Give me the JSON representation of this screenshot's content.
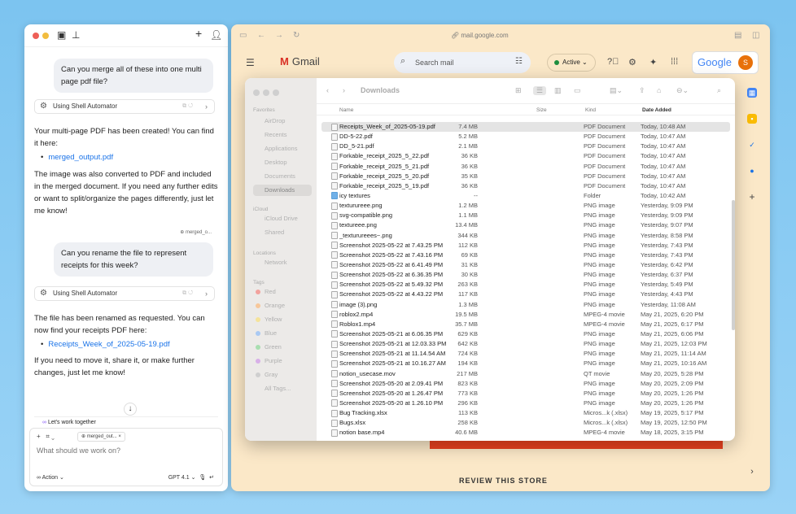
{
  "chat": {
    "messages": {
      "user1": "Can you merge all of these into one multi page pdf file?",
      "tool1": "Using Shell Automator",
      "reply1_a": "Your multi-page PDF has been created! You can find it here:",
      "reply1_link": "merged_output.pdf",
      "reply1_b": "The image was also converted to PDF and included in the merged document. If you need any further edits or want to split/organize the pages differently, just let me know!",
      "attachment_tag": "merged_o...",
      "user2": "Can you rename the file to represent receipts for this week?",
      "tool2": "Using Shell Automator",
      "reply2_a": "The file has been renamed as requested. You can now find your receipts PDF here:",
      "reply2_link": "Receipts_Week_of_2025-05-19.pdf",
      "reply2_b": "If you need to move it, share it, or make further changes, just let me know!"
    },
    "lets_work": "Let's work together",
    "composer": {
      "chip": "merged_out...",
      "placeholder": "What should we work on?",
      "action": "Action",
      "model": "GPT 4.1"
    }
  },
  "browser": {
    "url": "mail.google.com",
    "gmail_label": "Gmail",
    "search_placeholder": "Search mail",
    "status": "Active",
    "google_label": "Google",
    "avatar_letter": "S",
    "review_text": "REVIEW THIS STORE"
  },
  "finder": {
    "title": "Downloads",
    "sidebar": {
      "favorites_label": "Favorites",
      "favorites": [
        "AirDrop",
        "Recents",
        "Applications",
        "Desktop",
        "Documents",
        "Downloads"
      ],
      "icloud_label": "iCloud",
      "icloud": [
        "iCloud Drive",
        "Shared"
      ],
      "locations_label": "Locations",
      "locations": [
        "Network"
      ],
      "tags_label": "Tags",
      "tags": [
        "Red",
        "Orange",
        "Yellow",
        "Blue",
        "Green",
        "Purple",
        "Gray",
        "All Tags..."
      ],
      "tag_colors": [
        "#f2a29d",
        "#f7c79a",
        "#f5e39a",
        "#a9c9f3",
        "#a8deb0",
        "#d8b0e8",
        "#cfcfcf",
        ""
      ]
    },
    "columns": {
      "name": "Name",
      "size": "Size",
      "kind": "Kind",
      "date": "Date Added"
    },
    "files": [
      {
        "name": "Receipts_Week_of_2025-05-19.pdf",
        "size": "7.4 MB",
        "kind": "PDF Document",
        "date": "Today, 10:48 AM"
      },
      {
        "name": "DD-5-22.pdf",
        "size": "5.2 MB",
        "kind": "PDF Document",
        "date": "Today, 10:47 AM"
      },
      {
        "name": "DD_5-21.pdf",
        "size": "2.1 MB",
        "kind": "PDF Document",
        "date": "Today, 10:47 AM"
      },
      {
        "name": "Forkable_receipt_2025_5_22.pdf",
        "size": "36 KB",
        "kind": "PDF Document",
        "date": "Today, 10:47 AM"
      },
      {
        "name": "Forkable_receipt_2025_5_21.pdf",
        "size": "36 KB",
        "kind": "PDF Document",
        "date": "Today, 10:47 AM"
      },
      {
        "name": "Forkable_receipt_2025_5_20.pdf",
        "size": "35 KB",
        "kind": "PDF Document",
        "date": "Today, 10:47 AM"
      },
      {
        "name": "Forkable_receipt_2025_5_19.pdf",
        "size": "36 KB",
        "kind": "PDF Document",
        "date": "Today, 10:47 AM"
      },
      {
        "name": "icy textures",
        "size": "--",
        "kind": "Folder",
        "date": "Today, 10:42 AM"
      },
      {
        "name": "texturureee.png",
        "size": "1.2 MB",
        "kind": "PNG image",
        "date": "Yesterday, 9:09 PM"
      },
      {
        "name": "svg-compatible.png",
        "size": "1.1 MB",
        "kind": "PNG image",
        "date": "Yesterday, 9:09 PM"
      },
      {
        "name": "textureee.png",
        "size": "13.4 MB",
        "kind": "PNG image",
        "date": "Yesterday, 9:07 PM"
      },
      {
        "name": "_texturureees~.png",
        "size": "344 KB",
        "kind": "PNG image",
        "date": "Yesterday, 8:58 PM"
      },
      {
        "name": "Screenshot 2025-05-22 at 7.43.25 PM",
        "size": "112 KB",
        "kind": "PNG image",
        "date": "Yesterday, 7:43 PM"
      },
      {
        "name": "Screenshot 2025-05-22 at 7.43.16 PM",
        "size": "69 KB",
        "kind": "PNG image",
        "date": "Yesterday, 7:43 PM"
      },
      {
        "name": "Screenshot 2025-05-22 at 6.41.49 PM",
        "size": "31 KB",
        "kind": "PNG image",
        "date": "Yesterday, 6:42 PM"
      },
      {
        "name": "Screenshot 2025-05-22 at 6.36.35 PM",
        "size": "30 KB",
        "kind": "PNG image",
        "date": "Yesterday, 6:37 PM"
      },
      {
        "name": "Screenshot 2025-05-22 at 5.49.32 PM",
        "size": "263 KB",
        "kind": "PNG image",
        "date": "Yesterday, 5:49 PM"
      },
      {
        "name": "Screenshot 2025-05-22 at 4.43.22 PM",
        "size": "117 KB",
        "kind": "PNG image",
        "date": "Yesterday, 4:43 PM"
      },
      {
        "name": "image (3).png",
        "size": "1.3 MB",
        "kind": "PNG image",
        "date": "Yesterday, 11:08 AM"
      },
      {
        "name": "roblox2.mp4",
        "size": "19.5 MB",
        "kind": "MPEG-4 movie",
        "date": "May 21, 2025, 6:20 PM"
      },
      {
        "name": "Roblox1.mp4",
        "size": "35.7 MB",
        "kind": "MPEG-4 movie",
        "date": "May 21, 2025, 6:17 PM"
      },
      {
        "name": "Screenshot 2025-05-21 at 6.06.35 PM",
        "size": "629 KB",
        "kind": "PNG image",
        "date": "May 21, 2025, 6:06 PM"
      },
      {
        "name": "Screenshot 2025-05-21 at 12.03.33 PM",
        "size": "642 KB",
        "kind": "PNG image",
        "date": "May 21, 2025, 12:03 PM"
      },
      {
        "name": "Screenshot 2025-05-21 at 11.14.54 AM",
        "size": "724 KB",
        "kind": "PNG image",
        "date": "May 21, 2025, 11:14 AM"
      },
      {
        "name": "Screenshot 2025-05-21 at 10.16.27 AM",
        "size": "194 KB",
        "kind": "PNG image",
        "date": "May 21, 2025, 10:16 AM"
      },
      {
        "name": "notion_usecase.mov",
        "size": "217 MB",
        "kind": "QT movie",
        "date": "May 20, 2025, 5:28 PM"
      },
      {
        "name": "Screenshot 2025-05-20 at 2.09.41 PM",
        "size": "823 KB",
        "kind": "PNG image",
        "date": "May 20, 2025, 2:09 PM"
      },
      {
        "name": "Screenshot 2025-05-20 at 1.26.47 PM",
        "size": "773 KB",
        "kind": "PNG image",
        "date": "May 20, 2025, 1:26 PM"
      },
      {
        "name": "Screenshot 2025-05-20 at 1.26.10 PM",
        "size": "296 KB",
        "kind": "PNG image",
        "date": "May 20, 2025, 1:26 PM"
      },
      {
        "name": "Bug Tracking.xlsx",
        "size": "113 KB",
        "kind": "Micros...k (.xlsx)",
        "date": "May 19, 2025, 5:17 PM"
      },
      {
        "name": "Bugs.xlsx",
        "size": "258 KB",
        "kind": "Micros...k (.xlsx)",
        "date": "May 19, 2025, 12:50 PM"
      },
      {
        "name": "notion base.mp4",
        "size": "40.6 MB",
        "kind": "MPEG-4 movie",
        "date": "May 18, 2025, 3:15 PM"
      }
    ]
  }
}
